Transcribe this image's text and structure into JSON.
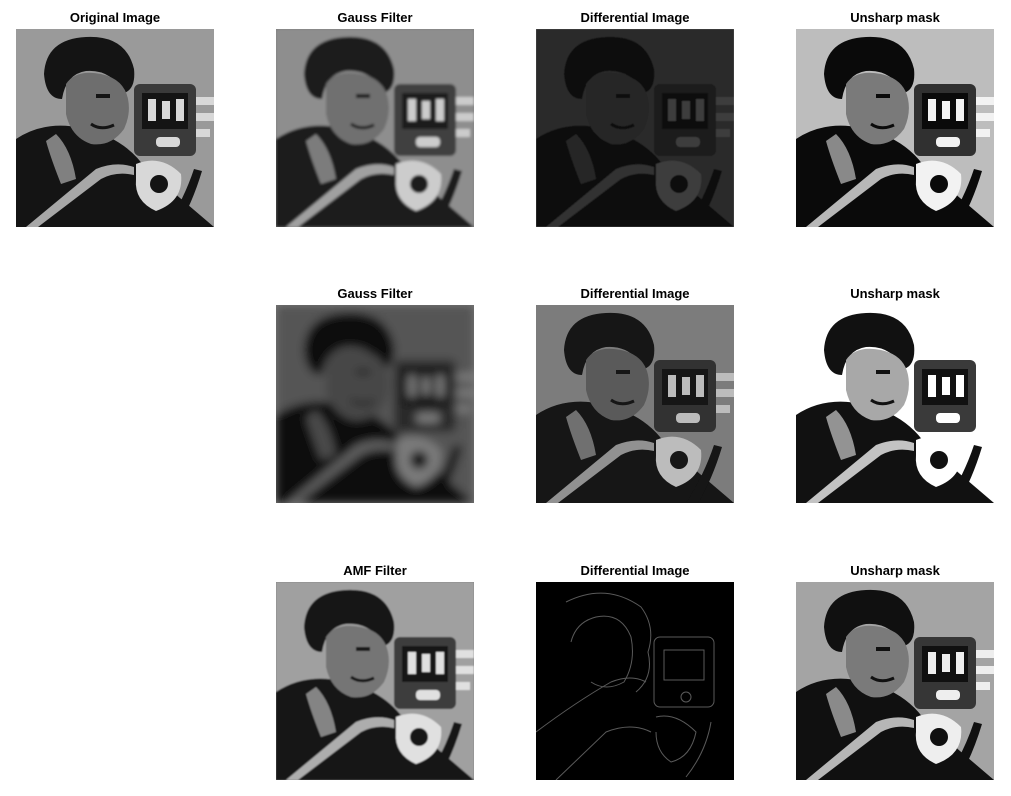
{
  "figure": {
    "panels": [
      {
        "id": "original",
        "title": "Original Image",
        "style": "original"
      },
      {
        "id": "gauss1",
        "title": "Gauss Filter",
        "style": "gauss1"
      },
      {
        "id": "diff1",
        "title": "Differential Image",
        "style": "diff1"
      },
      {
        "id": "unsharp1",
        "title": "Unsharp mask",
        "style": "unsharp1"
      },
      {
        "id": "gauss2",
        "title": "Gauss Filter",
        "style": "gauss2"
      },
      {
        "id": "diff2",
        "title": "Differential Image",
        "style": "diff2"
      },
      {
        "id": "unsharp2",
        "title": "Unsharp mask",
        "style": "unsharp2"
      },
      {
        "id": "amf",
        "title": "AMF Filter",
        "style": "amf"
      },
      {
        "id": "diff3",
        "title": "Differential Image",
        "style": "diff3"
      },
      {
        "id": "unsharp3",
        "title": "Unsharp mask",
        "style": "unsharp3"
      }
    ]
  }
}
